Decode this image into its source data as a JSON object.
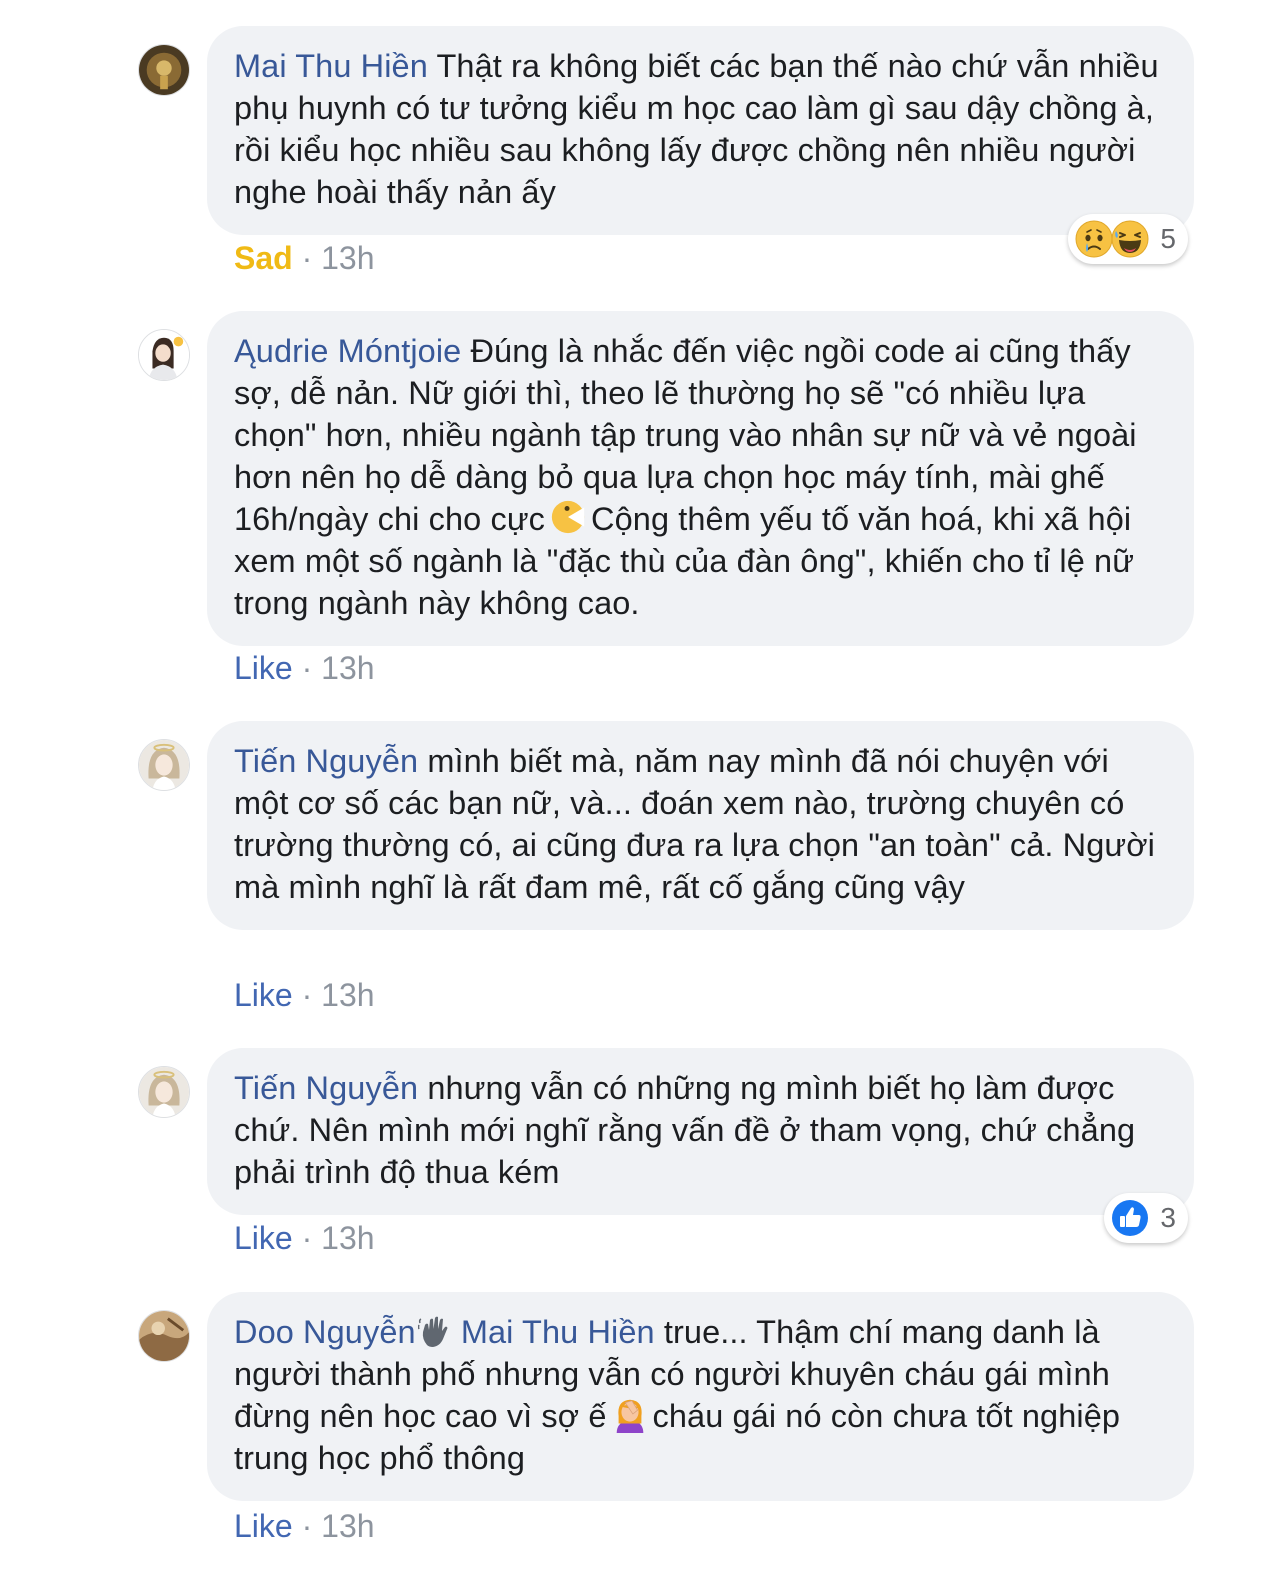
{
  "comments": [
    {
      "author": "Mai Thu Hiền",
      "text": "Thật ra không biết các bạn thế nào chứ vẫn nhiều phụ huynh có tư tưởng kiểu m học cao làm gì sau dậy chồng à, rồi kiểu học nhiều sau không lấy được chồng nên nhiều người nghe hoài thấy nản ấy",
      "action": "Sad",
      "time": "13h",
      "reaction_count": "5",
      "reaction_icons": [
        "sad-face-icon",
        "haha-face-icon"
      ]
    },
    {
      "author": "Ąudrie Móntjoie",
      "text_before": "Đúng là nhắc đến việc ngồi code ai cũng thấy sợ, dễ nản. Nữ giới thì, theo lẽ thường họ sẽ \"có nhiều lựa chọn\" hơn, nhiều ngành tập trung vào nhân sự nữ và vẻ ngoài hơn nên họ dễ dàng bỏ qua lựa chọn học máy tính, mài ghế 16h/ngày chi cho cực",
      "text_after": "Cộng thêm yếu tố văn hoá, khi xã hội xem một số ngành là \"đặc thù của đàn ông\", khiến cho tỉ lệ nữ trong ngành này không cao.",
      "emoji": "pacman-emoji-icon",
      "action": "Like",
      "time": "13h"
    },
    {
      "author": "Tiến Nguyễn",
      "text": "mình biết mà, năm nay mình đã nói chuyện với một cơ số các bạn nữ, và... đoán xem nào, trường chuyên có trường thường có, ai cũng đưa ra lựa chọn \"an toàn\" cả. Người mà mình nghĩ là rất đam mê, rất cố gắng cũng vậy",
      "action": "Like",
      "time": "13h"
    },
    {
      "author": "Tiến Nguyễn",
      "text": "nhưng vẫn có những ng mình biết họ làm được chứ. Nên mình mới nghĩ rằng vấn đề ở tham vọng, chứ chẳng phải trình độ thua kém",
      "action": "Like",
      "time": "13h",
      "reaction_count": "3",
      "reaction_icons": [
        "thumbs-up-icon"
      ]
    },
    {
      "author": "Doo Nguyễn",
      "author_icon": "waving-hand-icon",
      "mention": "Mai Thu Hiền",
      "text_before": "true... Thậm chí mang danh là người thành phố nhưng vẫn có người khuyên cháu gái mình đừng nên học cao vì sợ ế",
      "text_after": "cháu gái nó còn chưa tốt nghiệp trung học phổ thông",
      "emoji": "face-palm-woman-emoji-icon",
      "action": "Like",
      "time": "13h"
    }
  ],
  "separator": "·",
  "colors": {
    "author": "#385898",
    "bubble": "#f0f2f5",
    "like": "#4267b2",
    "sad": "#f0ba15",
    "meta": "#8d949e"
  }
}
